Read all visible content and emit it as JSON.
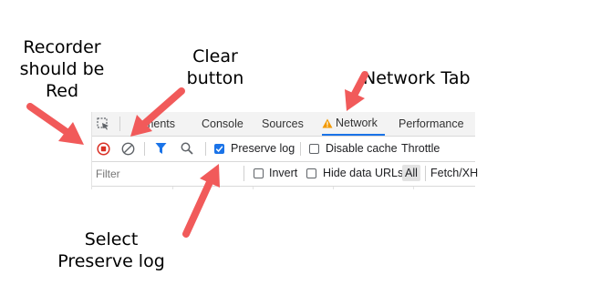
{
  "annotations": {
    "recorder": "Recorder\nshould be\nRed",
    "clear": "Clear\nbutton",
    "network_tab": "Network Tab",
    "preserve": "Select\nPreserve log"
  },
  "devtools": {
    "tabs": [
      "Elements",
      "Console",
      "Sources",
      "Network",
      "Performance"
    ],
    "tabs_visible": [
      "ements",
      "Console",
      "Sources",
      "Network",
      "Performance"
    ],
    "active_tab": "Network",
    "toolbar": {
      "preserve_log_label": "Preserve log",
      "preserve_log_checked": true,
      "disable_cache_label": "Disable cache",
      "disable_cache_checked": false,
      "throttle_label": "Throttle"
    },
    "filter": {
      "placeholder": "Filter",
      "invert_label": "Invert",
      "hide_data_urls_label": "Hide data URLs",
      "all_label": "All",
      "fetch_label": "Fetch/XH"
    }
  },
  "icons": {
    "record": "record-stop-icon",
    "clear": "clear-circle-icon",
    "filter": "funnel-icon",
    "search": "magnifier-icon",
    "inspect": "inspect-element-icon",
    "warning": "warning-triangle-icon"
  },
  "colors": {
    "record_red": "#d93025",
    "annotation_arrow": "#f15a5a",
    "accent_blue": "#1a73e8",
    "warning_orange": "#f29900"
  }
}
